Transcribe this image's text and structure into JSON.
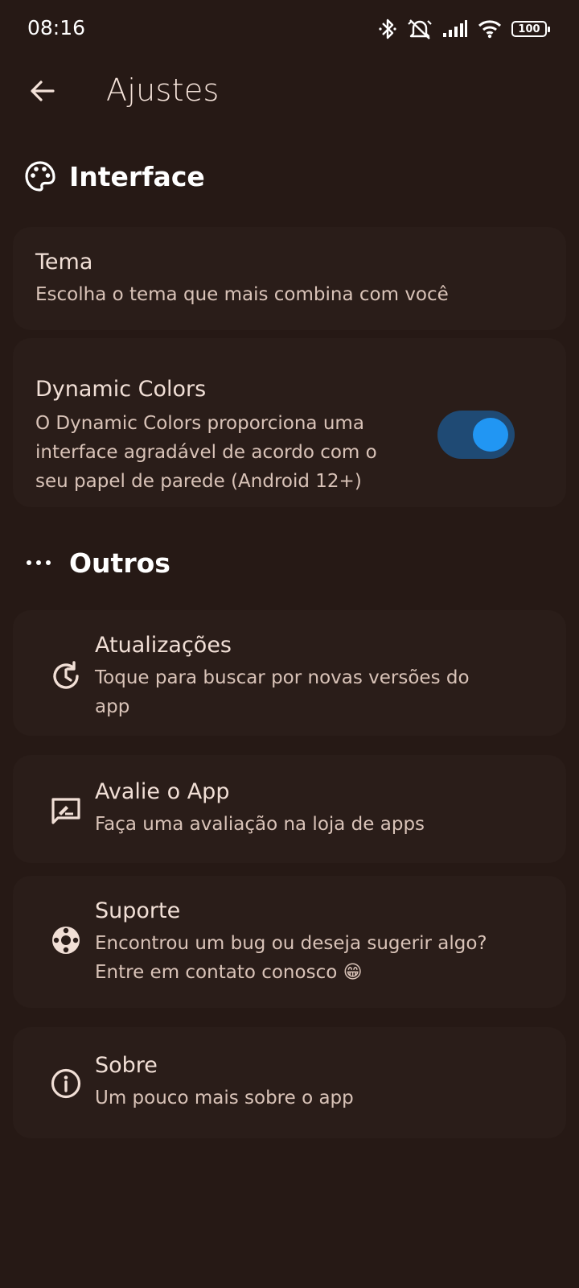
{
  "status_bar": {
    "time": "08:16",
    "battery": "100",
    "icons": [
      "bluetooth-icon",
      "silent-icon",
      "signal-icon",
      "wifi-icon",
      "battery-icon"
    ]
  },
  "appbar": {
    "title": "Ajustes",
    "back_icon": "arrow-back-icon"
  },
  "interface_section": {
    "title": "Interface",
    "icon": "palette-icon",
    "items": [
      {
        "title": "Tema",
        "subtitle": "Escolha o tema que mais combina com você"
      },
      {
        "title": "Dynamic Colors",
        "subtitle_lines": [
          "O Dynamic Colors proporciona uma",
          "interface agradável de acordo com o",
          "seu papel de parede (Android 12+)"
        ],
        "toggle_on": true
      }
    ]
  },
  "outros_section": {
    "title": "Outros",
    "icon": "more-horizontal-icon",
    "items": [
      {
        "title": "Atualizações",
        "subtitle_lines": [
          "Toque para buscar por novas versões do",
          "app"
        ],
        "icon": "update-icon"
      },
      {
        "title": "Avalie o App",
        "subtitle_lines": [
          "Faça uma avaliação na loja de apps"
        ],
        "icon": "rate-review-icon"
      },
      {
        "title": "Suporte",
        "subtitle_lines": [
          "Encontrou um bug ou deseja sugerir algo?",
          "Entre em contato conosco 😁"
        ],
        "icon": "support-icon"
      },
      {
        "title": "Sobre",
        "subtitle_lines": [
          "Um pouco mais sobre o app"
        ],
        "icon": "info-icon"
      }
    ]
  },
  "colors": {
    "background": "#261915",
    "card": "#2a1d19",
    "text": "#f1dfd6",
    "toggle_track": "#1f4a74",
    "toggle_knob": "#2196f3"
  }
}
